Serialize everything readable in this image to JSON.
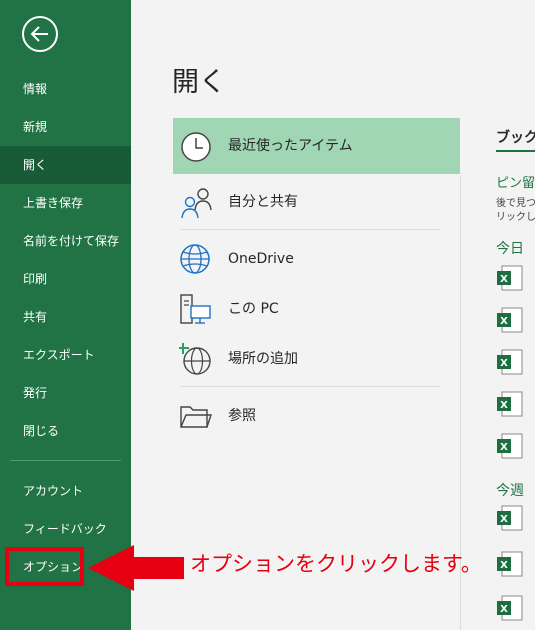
{
  "sidebar": {
    "items": [
      {
        "id": "info",
        "label": "情報"
      },
      {
        "id": "new",
        "label": "新規"
      },
      {
        "id": "open",
        "label": "開く",
        "active": true
      },
      {
        "id": "save",
        "label": "上書き保存"
      },
      {
        "id": "save-as",
        "label": "名前を付けて保存"
      },
      {
        "id": "print",
        "label": "印刷"
      },
      {
        "id": "share",
        "label": "共有"
      },
      {
        "id": "export",
        "label": "エクスポート"
      },
      {
        "id": "publish",
        "label": "発行"
      },
      {
        "id": "close",
        "label": "閉じる"
      }
    ],
    "bottom_items": [
      {
        "id": "account",
        "label": "アカウント"
      },
      {
        "id": "feedback",
        "label": "フィードバック"
      },
      {
        "id": "options",
        "label": "オプション"
      }
    ]
  },
  "main": {
    "title": "開く",
    "locations": [
      {
        "label": "最近使ったアイテム",
        "icon": "clock-icon",
        "active": true
      },
      {
        "label": "自分と共有",
        "icon": "shared-people-icon"
      },
      {
        "label": "OneDrive",
        "icon": "globe-icon"
      },
      {
        "label": "この PC",
        "icon": "this-pc-icon"
      },
      {
        "label": "場所の追加",
        "icon": "add-place-icon"
      },
      {
        "label": "参照",
        "icon": "folder-icon"
      }
    ]
  },
  "recent_panel": {
    "header": "ブック",
    "pinned": "ピン留め",
    "pinned_desc_1": "後で見つ",
    "pinned_desc_2": "リックしま",
    "group_today": "今日",
    "group_this_week": "今週"
  },
  "annotation": {
    "text": "オプションをクリックします。"
  },
  "colors": {
    "sidebar": "#217346",
    "sidebar_active": "#185c37",
    "location_active": "#a0d6b4",
    "annotation_red": "#e60012"
  }
}
